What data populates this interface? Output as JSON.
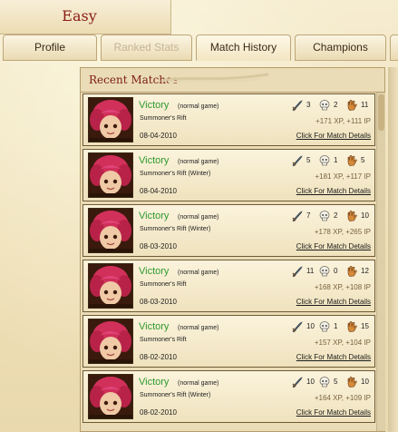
{
  "header": {
    "title": "Easy"
  },
  "tabs": [
    {
      "label": "Profile",
      "state": "normal"
    },
    {
      "label": "Ranked Stats",
      "state": "disabled"
    },
    {
      "label": "Match History",
      "state": "active"
    },
    {
      "label": "Champions",
      "state": "normal"
    }
  ],
  "panel": {
    "title": "Recent Matches"
  },
  "matches": [
    {
      "result": "Victory",
      "mode": "(normal game)",
      "map": "Summoner's Rift",
      "date": "08-04-2010",
      "kills": "3",
      "deaths": "2",
      "assists": "11",
      "reward": "+171 XP, +111 IP",
      "details_label": "Click For Match Details"
    },
    {
      "result": "Victory",
      "mode": "(normal game)",
      "map": "Summoner's Rift (Winter)",
      "date": "08-04-2010",
      "kills": "5",
      "deaths": "1",
      "assists": "5",
      "reward": "+181 XP, +117 IP",
      "details_label": "Click For Match Details"
    },
    {
      "result": "Victory",
      "mode": "(normal game)",
      "map": "Summoner's Rift (Winter)",
      "date": "08-03-2010",
      "kills": "7",
      "deaths": "2",
      "assists": "10",
      "reward": "+178 XP, +265 IP",
      "details_label": "Click For Match Details"
    },
    {
      "result": "Victory",
      "mode": "(normal game)",
      "map": "Summoner's Rift",
      "date": "08-03-2010",
      "kills": "11",
      "deaths": "0",
      "assists": "12",
      "reward": "+168 XP, +108 IP",
      "details_label": "Click For Match Details"
    },
    {
      "result": "Victory",
      "mode": "(normal game)",
      "map": "Summoner's Rift",
      "date": "08-02-2010",
      "kills": "10",
      "deaths": "1",
      "assists": "15",
      "reward": "+157 XP, +104 IP",
      "details_label": "Click For Match Details"
    },
    {
      "result": "Victory",
      "mode": "(normal game)",
      "map": "Summoner's Rift (Winter)",
      "date": "08-02-2010",
      "kills": "10",
      "deaths": "5",
      "assists": "10",
      "reward": "+164 XP, +109 IP",
      "details_label": "Click For Match Details"
    }
  ],
  "icons": {
    "kills": "sword-icon",
    "deaths": "skull-icon",
    "assists": "hand-icon",
    "champion": "champion-portrait"
  },
  "colors": {
    "victory": "#2e9a2e",
    "title": "#8a1c14",
    "panel_title": "#7c1c14"
  }
}
